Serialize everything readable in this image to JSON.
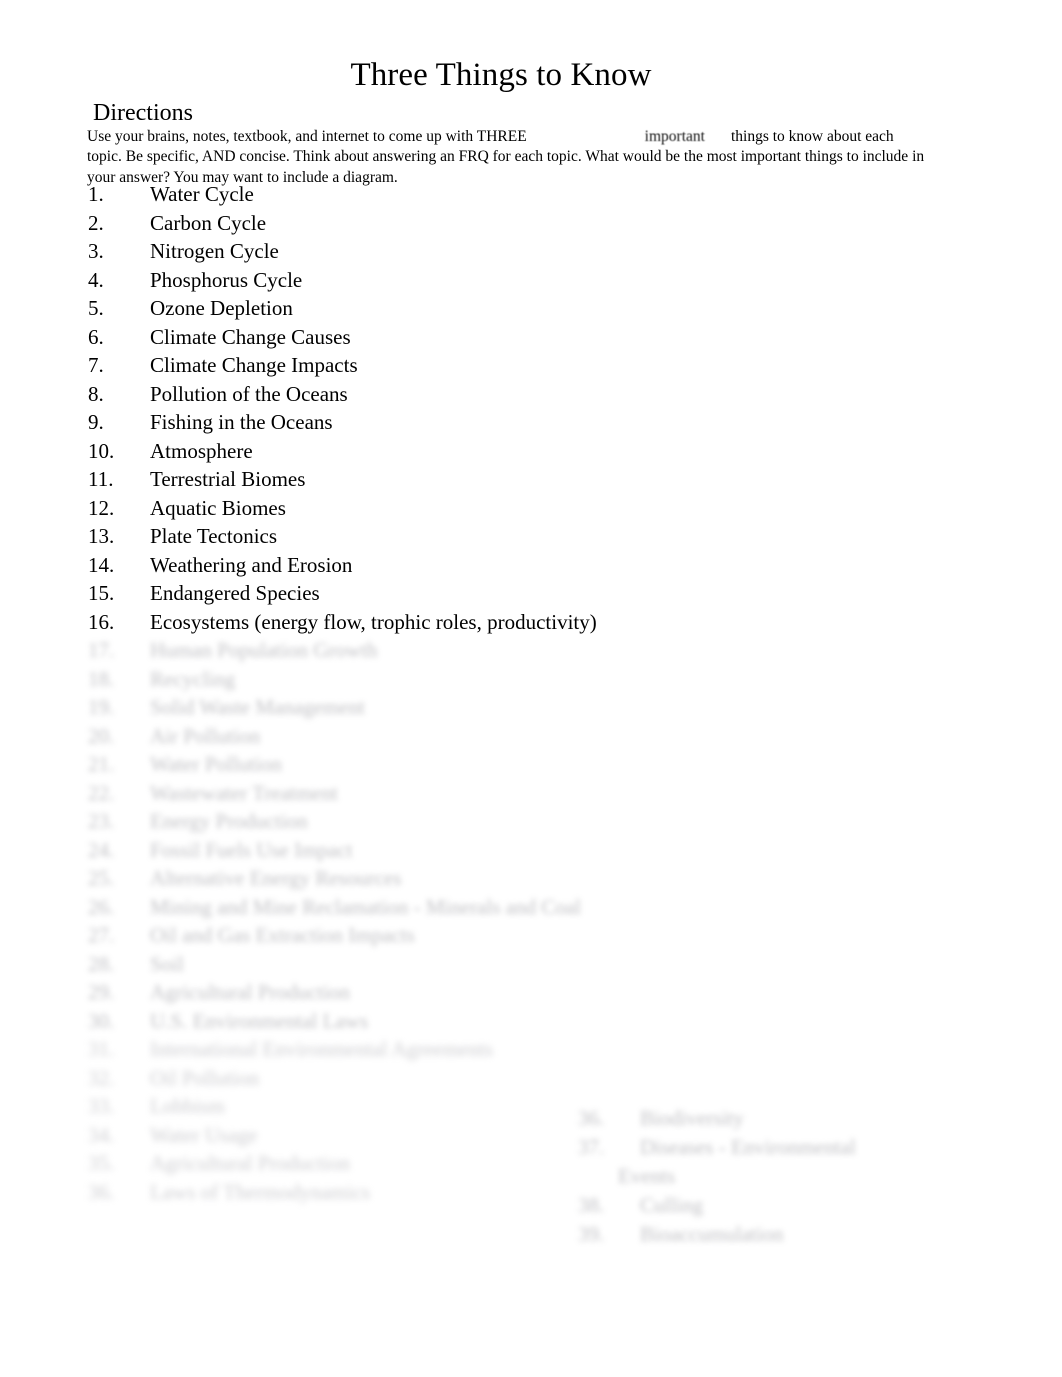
{
  "document": {
    "title": "Three Things to Know",
    "directions_heading": "Directions",
    "directions": {
      "part1": "Use your brains, notes, textbook, and internet to come up with THREE",
      "emphasis": "important",
      "part2": "things to know about each topic. Be specific, AND concise. Think about answering an FRQ for each topic. What would be the most important things to include in your answer? You may want to include a diagram."
    },
    "topics": [
      {
        "num": "1.",
        "label": "Water Cycle"
      },
      {
        "num": "2.",
        "label": "Carbon Cycle"
      },
      {
        "num": "3.",
        "label": "Nitrogen Cycle"
      },
      {
        "num": "4.",
        "label": "Phosphorus Cycle"
      },
      {
        "num": "5.",
        "label": "Ozone Depletion"
      },
      {
        "num": "6.",
        "label": "Climate Change Causes"
      },
      {
        "num": "7.",
        "label": "Climate Change Impacts"
      },
      {
        "num": "8.",
        "label": "Pollution of the Oceans"
      },
      {
        "num": "9.",
        "label": "Fishing in the Oceans"
      },
      {
        "num": "10.",
        "label": "Atmosphere"
      },
      {
        "num": "11.",
        "label": "Terrestrial Biomes"
      },
      {
        "num": "12.",
        "label": "Aquatic Biomes"
      },
      {
        "num": "13.",
        "label": "Plate Tectonics"
      },
      {
        "num": "14.",
        "label": "Weathering and Erosion"
      },
      {
        "num": "15.",
        "label": "Endangered Species"
      },
      {
        "num": "16.",
        "label": "Ecosystems (energy flow, trophic roles, productivity)"
      },
      {
        "num": "17.",
        "label": "Human Population Growth"
      },
      {
        "num": "18.",
        "label": "Recycling"
      },
      {
        "num": "19.",
        "label": "Solid Waste Management"
      },
      {
        "num": "20.",
        "label": "Air Pollution"
      },
      {
        "num": "21.",
        "label": "Water Pollution"
      },
      {
        "num": "22.",
        "label": "Wastewater Treatment"
      },
      {
        "num": "23.",
        "label": "Energy Production"
      },
      {
        "num": "24.",
        "label": "Fossil Fuels Use Impact"
      },
      {
        "num": "25.",
        "label": "Alternative Energy Resources"
      },
      {
        "num": "26.",
        "label": "Mining and Mine Reclamation - Minerals and Coal"
      },
      {
        "num": "27.",
        "label": "Oil and Gas Extraction Impacts"
      },
      {
        "num": "28.",
        "label": "Soil"
      },
      {
        "num": "29.",
        "label": "Agricultural Production"
      },
      {
        "num": "30.",
        "label": "U.S. Environmental Laws"
      },
      {
        "num": "31.",
        "label": "International Environmental Agreements"
      },
      {
        "num": "32.",
        "label": "Oil Pollution"
      },
      {
        "num": "33.",
        "label": "Lobbism"
      },
      {
        "num": "34.",
        "label": "Water Usage"
      },
      {
        "num": "35.",
        "label": "Agricultural Production"
      },
      {
        "num": "36.",
        "label": "Laws of Thermodynamics"
      }
    ],
    "right_column": [
      {
        "num": "36.",
        "label": "Biodiversity"
      },
      {
        "num": "37.",
        "label": "Diseases - Environmental"
      }
    ],
    "right_column_continuation": "Events",
    "right_column_tail": [
      {
        "num": "38.",
        "label": "Culling"
      },
      {
        "num": "39.",
        "label": "Bioaccumulation"
      }
    ]
  }
}
